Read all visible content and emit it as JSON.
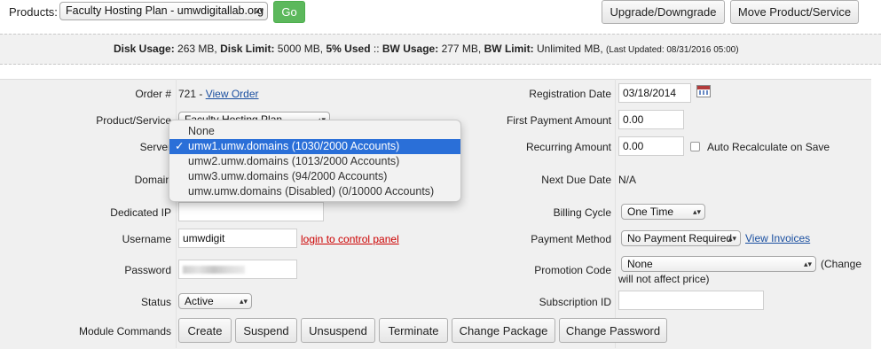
{
  "topbar": {
    "products_label": "Products:",
    "product_selected": "Faculty Hosting Plan - umwdigitallab.org",
    "go_label": "Go",
    "upgrade_label": "Upgrade/Downgrade",
    "move_label": "Move Product/Service"
  },
  "usage": {
    "disk_usage_label": "Disk Usage:",
    "disk_usage_value": "263 MB,",
    "disk_limit_label": "Disk Limit:",
    "disk_limit_value": "5000 MB,",
    "used_label": "5% Used",
    "sep": "::",
    "bw_usage_label": "BW Usage:",
    "bw_usage_value": "277 MB,",
    "bw_limit_label": "BW Limit:",
    "bw_limit_value": "Unlimited MB,",
    "last_updated": "(Last Updated: 08/31/2016 05:00)"
  },
  "left": {
    "order_label": "Order #",
    "order_value": "721 -",
    "view_order": "View Order",
    "product_label": "Product/Service",
    "product_value": "Faculty Hosting Plan",
    "server_label": "Server",
    "domain_label": "Domain",
    "dedicated_ip_label": "Dedicated IP",
    "dedicated_ip_value": "",
    "username_label": "Username",
    "username_value": "umwdigit",
    "login_link": "login to control panel",
    "password_label": "Password",
    "status_label": "Status",
    "status_value": "Active"
  },
  "right": {
    "reg_date_label": "Registration Date",
    "reg_date_value": "03/18/2014",
    "first_payment_label": "First Payment Amount",
    "first_payment_value": "0.00",
    "recurring_label": "Recurring Amount",
    "recurring_value": "0.00",
    "auto_recalc_label": "Auto Recalculate on Save",
    "next_due_label": "Next Due Date",
    "next_due_value": "N/A",
    "billing_cycle_label": "Billing Cycle",
    "billing_cycle_value": "One Time",
    "payment_method_label": "Payment Method",
    "payment_method_value": "No Payment Required",
    "view_invoices": "View Invoices",
    "promo_label": "Promotion Code",
    "promo_value": "None",
    "promo_note_1": "(Change",
    "promo_note_2": "will not affect price)",
    "subscription_label": "Subscription ID",
    "subscription_value": ""
  },
  "server_dropdown": {
    "check": "✓",
    "options": [
      "None",
      "umw1.umw.domains (1030/2000 Accounts)",
      "umw2.umw.domains (1013/2000 Accounts)",
      "umw3.umw.domains (94/2000 Accounts)",
      "umw.umw.domains (Disabled) (0/10000 Accounts)"
    ],
    "selected_index": 1
  },
  "module": {
    "label": "Module Commands",
    "buttons": [
      "Create",
      "Suspend",
      "Unsuspend",
      "Terminate",
      "Change Package",
      "Change Password"
    ]
  },
  "icons": {
    "calendar": "calendar-icon",
    "select_arrow": "chevron-updown-icon",
    "checkmark": "checkmark-icon"
  },
  "colors": {
    "go_green": "#5cb85c",
    "selected_blue": "#2a6fd8",
    "link_blue": "#1a4fa0",
    "login_red": "#cc0000",
    "panel_bg": "#f0f0f0"
  }
}
